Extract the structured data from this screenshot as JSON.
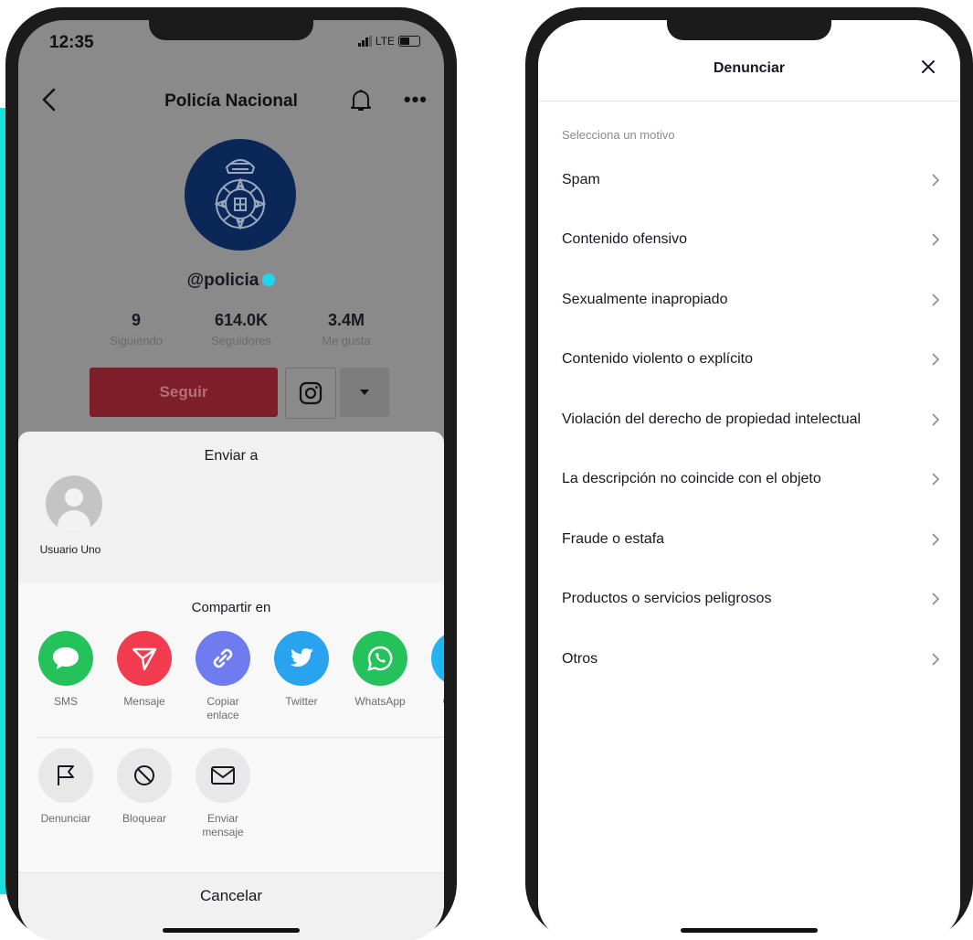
{
  "left_phone": {
    "status": {
      "time": "12:35",
      "network": "LTE"
    },
    "header": {
      "title": "Policía Nacional"
    },
    "profile": {
      "handle": "@policia",
      "stats": [
        {
          "value": "9",
          "label": "Siguiendo"
        },
        {
          "value": "614.0K",
          "label": "Seguidores"
        },
        {
          "value": "3.4M",
          "label": "Me gusta"
        }
      ],
      "follow_label": "Seguir"
    },
    "sheet": {
      "send_title": "Enviar a",
      "contact_name": "Usuario Uno",
      "share_title": "Compartir en",
      "share_items": [
        {
          "label": "SMS",
          "icon": "sms-icon",
          "color": "#25c25c"
        },
        {
          "label": "Mensaje",
          "icon": "send-icon",
          "color": "#f23b4f"
        },
        {
          "label": "Copiar enlace",
          "icon": "link-icon",
          "color": "#6e7cf0"
        },
        {
          "label": "Twitter",
          "icon": "twitter-icon",
          "color": "#2aa3ef"
        },
        {
          "label": "WhatsApp",
          "icon": "whatsapp-icon",
          "color": "#25c25c"
        },
        {
          "label": "Co ele",
          "icon": "email-icon",
          "color": "#1eb5f0"
        }
      ],
      "actions": [
        {
          "label": "Denunciar",
          "icon": "flag-icon"
        },
        {
          "label": "Bloquear",
          "icon": "block-icon"
        },
        {
          "label": "Enviar mensaje",
          "icon": "mail-icon"
        }
      ],
      "cancel_label": "Cancelar"
    }
  },
  "right_phone": {
    "header": {
      "title": "Denunciar"
    },
    "subtitle": "Selecciona un motivo",
    "reasons": [
      "Spam",
      "Contenido ofensivo",
      "Sexualmente inapropiado",
      "Contenido violento o explícito",
      "Violación del derecho de propiedad intelectual",
      "La descripción no coincide con el objeto",
      "Fraude o estafa",
      "Productos o servicios peligrosos",
      "Otros"
    ]
  },
  "colors": {
    "accent_bar": "#19e0de",
    "follow_button": "#7d1e29",
    "police_badge": "#0b2757"
  }
}
